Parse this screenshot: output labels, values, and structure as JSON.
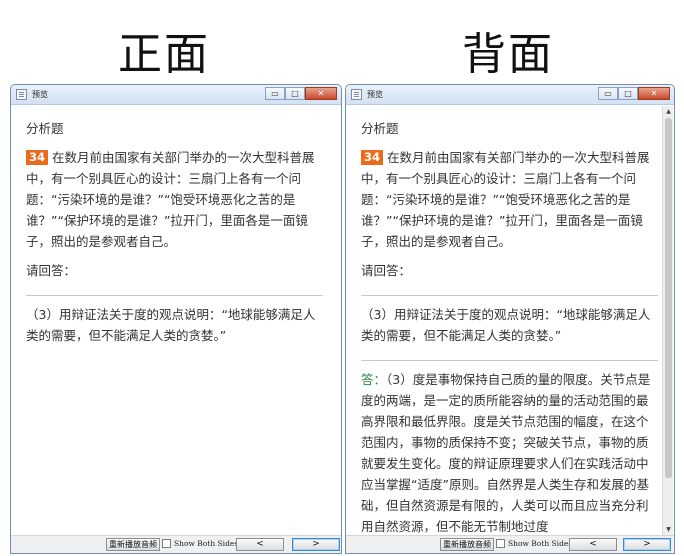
{
  "labels": {
    "front": "正面",
    "back": "背面"
  },
  "window": {
    "title": "预览",
    "controls": {
      "minimize": "▭",
      "maximize": "□",
      "close": "✕"
    }
  },
  "question": {
    "type": "分析题",
    "number": "34",
    "text": "在数月前由国家有关部门举办的一次大型科普展中，有一个别具匠心的设计：三扇门上各有一个问题：“污染环境的是谁？”“饱受环境恶化之苦的是谁？”“保护环境的是谁？”拉开门，里面各是一面镜子，照出的是参观者自己。",
    "prompt": "请回答：",
    "sub": "（3）用辩证法关于度的观点说明：“地球能够满足人类的需要，但不能满足人类的贪婪。”"
  },
  "answer": {
    "prefix": "答：",
    "text": "（3）度是事物保持自己质的量的限度。关节点是度的两端，是一定的质所能容纳的量的活动范围的最高界限和最低界限。度是关节点范围的幅度，在这个范围内，事物的质保持不变；突破关节点，事物的质就要发生变化。度的辩证原理要求人们在实践活动中应当掌握“适度”原则。自然界是人类生存和发展的基础，但自然资源是有限的，人类可以而且应当充分利用自然资源，但不能无节制地过度"
  },
  "bottom": {
    "replay": "重新播放音频",
    "show_both": "Show Both Sides",
    "prev": "<",
    "next": ">"
  },
  "scrollbar": {
    "up": "▲",
    "down": "▼"
  }
}
